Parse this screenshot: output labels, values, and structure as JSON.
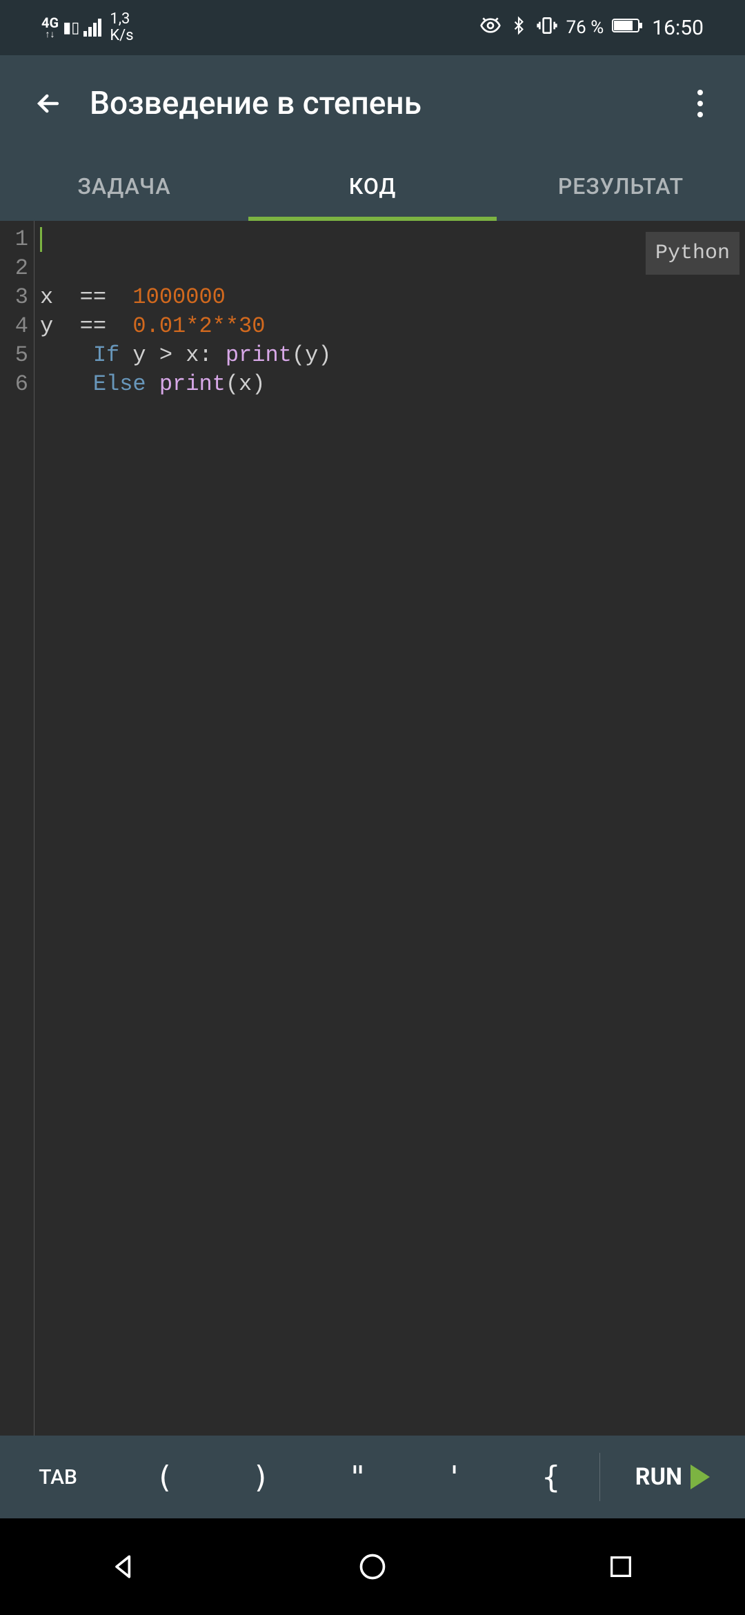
{
  "status": {
    "network": "4G",
    "speed_value": "1,3",
    "speed_unit": "K/s",
    "battery_pct": "76 %",
    "time": "16:50"
  },
  "header": {
    "title": "Возведение в степень"
  },
  "tabs": [
    {
      "label": "ЗАДАЧА",
      "active": false
    },
    {
      "label": "КОД",
      "active": true
    },
    {
      "label": "РЕЗУЛЬТАТ",
      "active": false
    }
  ],
  "editor": {
    "language": "Python",
    "line_numbers": [
      "1",
      "2",
      "3",
      "4",
      "5",
      "6"
    ],
    "lines": {
      "l1": "",
      "l2": "",
      "l3_var": "x ",
      "l3_op": " == ",
      "l3_num": " 1000000",
      "l4_var": "y ",
      "l4_op": " == ",
      "l4_num": " 0.01*2**30",
      "l5_pad": "    ",
      "l5_kw": "If",
      "l5_mid": " y > x: ",
      "l5_fn": "print",
      "l5_arg": "(y)",
      "l6_pad": "    ",
      "l6_kw": "Else",
      "l6_sp": " ",
      "l6_fn": "print",
      "l6_arg": "(x)"
    }
  },
  "toolbar": {
    "tab_label": "TAB",
    "sym_lparen": "(",
    "sym_rparen": ")",
    "sym_dquote": "\"",
    "sym_squote": "'",
    "sym_lbrace": "{",
    "run_label": "RUN"
  }
}
